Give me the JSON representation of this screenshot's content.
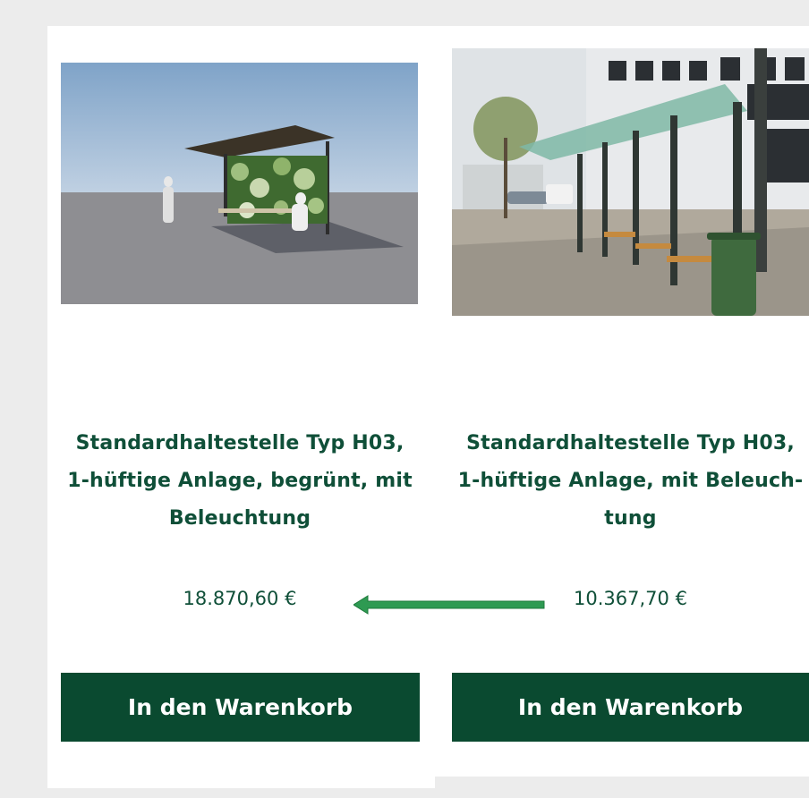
{
  "products": [
    {
      "title_lines": [
        "Standardhaltestelle Typ H03,",
        "1-hüftige Anlage, begrünt, mit",
        "Beleuchtung"
      ],
      "price": "18.870,60 €",
      "button_label": "In den Warenkorb"
    },
    {
      "title_lines": [
        "Standardhaltestelle Typ H03,",
        "1-hüftige Anlage, mit Beleuch-",
        "tung"
      ],
      "price": "10.367,70 €",
      "button_label": "In den Warenkorb"
    }
  ],
  "colors": {
    "brand_green": "#0a4a30",
    "text_green": "#0f4f38",
    "arrow_green": "#2e9a52",
    "page_bg": "#ececec"
  }
}
